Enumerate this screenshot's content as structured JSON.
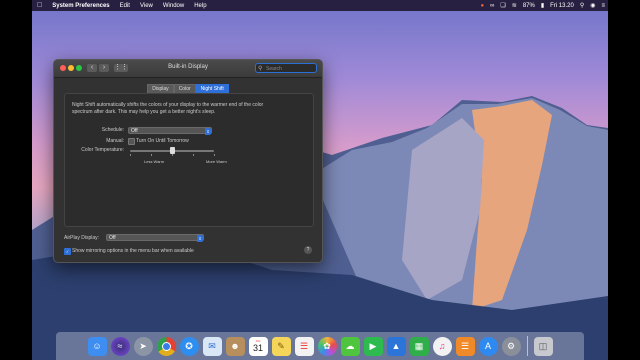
{
  "menubar": {
    "apple": "",
    "app_name": "System Preferences",
    "items": [
      "Edit",
      "View",
      "Window",
      "Help"
    ],
    "right": {
      "battery": "87%",
      "clock": "Fri 13.20"
    }
  },
  "window": {
    "title": "Built-in Display",
    "search_placeholder": "Search",
    "tabs": [
      {
        "label": "Display",
        "active": false
      },
      {
        "label": "Color",
        "active": false
      },
      {
        "label": "Night Shift",
        "active": true
      }
    ],
    "description": "Night Shift automatically shifts the colors of your display to the warmer end of the color spectrum after dark. This may help you get a better night's sleep.",
    "schedule": {
      "label": "Schedule:",
      "value": "Off"
    },
    "manual": {
      "label": "Manual:",
      "checkbox_label": "Turn On Until Tomorrow",
      "checked": false
    },
    "color_temperature": {
      "label": "Color Temperature:",
      "min_label": "Less Warm",
      "max_label": "More Warm",
      "level": 0.5
    },
    "airplay": {
      "label": "AirPlay Display:",
      "value": "Off"
    },
    "mirroring": {
      "label": "Show mirroring options in the menu bar when available",
      "checked": true
    },
    "help": "?"
  },
  "dock": {
    "calendar_day": "31",
    "calendar_month": "JUL",
    "apps": [
      {
        "name": "Finder",
        "icon": "finder-icon",
        "color": "#3e8ef2"
      },
      {
        "name": "Siri",
        "icon": "siri-icon",
        "color": "#7c4ddb"
      },
      {
        "name": "Launchpad",
        "icon": "rocket-icon",
        "color": "#8b95a6"
      },
      {
        "name": "Chrome",
        "icon": "chrome-icon",
        "color": "#e3ae1b"
      },
      {
        "name": "Safari",
        "icon": "compass-icon",
        "color": "#2d8ef0"
      },
      {
        "name": "Mail",
        "icon": "mail-icon",
        "color": "#d8e6f6"
      },
      {
        "name": "Contacts",
        "icon": "contacts-icon",
        "color": "#b68f5c"
      },
      {
        "name": "Calendar",
        "icon": "calendar-icon",
        "color": "#ffffff"
      },
      {
        "name": "Notes",
        "icon": "notes-icon",
        "color": "#f6d65a"
      },
      {
        "name": "Reminders",
        "icon": "reminders-icon",
        "color": "#f2f2f2"
      },
      {
        "name": "Photos",
        "icon": "photos-icon",
        "color": "#ffffff"
      },
      {
        "name": "Messages",
        "icon": "messages-icon",
        "color": "#4fc43f"
      },
      {
        "name": "FaceTime",
        "icon": "facetime-icon",
        "color": "#2dba4e"
      },
      {
        "name": "Keynote",
        "icon": "keynote-icon",
        "color": "#2b74d8"
      },
      {
        "name": "Numbers",
        "icon": "numbers-icon",
        "color": "#2fae49"
      },
      {
        "name": "iTunes",
        "icon": "music-icon",
        "color": "#f2f2f2"
      },
      {
        "name": "iBooks",
        "icon": "book-icon",
        "color": "#f08a28"
      },
      {
        "name": "App Store",
        "icon": "appstore-icon",
        "color": "#2e8af0"
      },
      {
        "name": "System Preferences",
        "icon": "gear-icon",
        "color": "#8a8f99"
      }
    ],
    "trash": {
      "name": "Trash",
      "icon": "trash-icon",
      "color": "#c7c9cf"
    }
  }
}
